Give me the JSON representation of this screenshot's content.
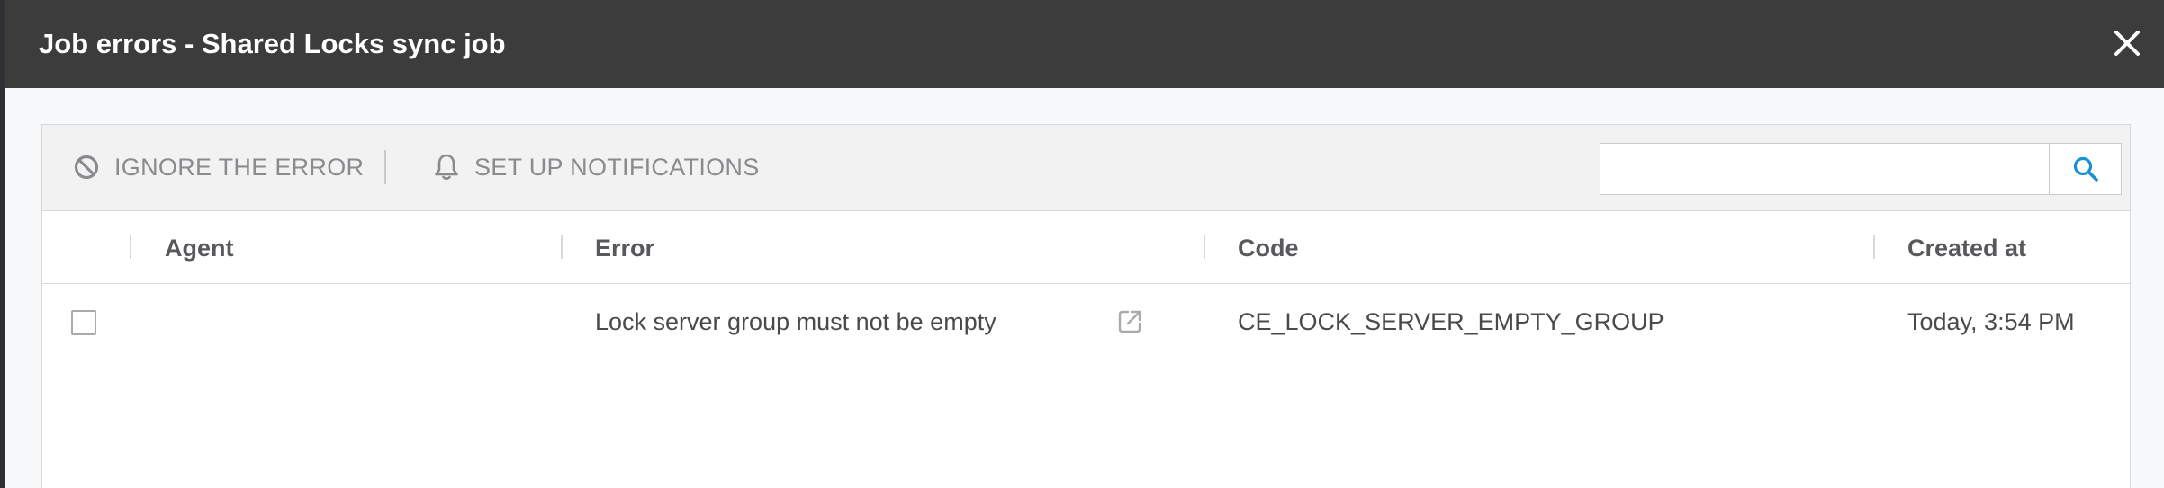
{
  "modal": {
    "title": "Job errors - Shared Locks sync job"
  },
  "toolbar": {
    "ignore_label": "IGNORE THE ERROR",
    "notifications_label": "SET UP NOTIFICATIONS",
    "search": {
      "value": "",
      "placeholder": ""
    }
  },
  "table": {
    "columns": [
      "Agent",
      "Error",
      "Code",
      "Created at"
    ],
    "rows": [
      {
        "agent": "",
        "error": "Lock server group must not be empty",
        "code": "CE_LOCK_SERVER_EMPTY_GROUP",
        "created_at": "Today, 3:54 PM"
      }
    ]
  },
  "icons": {
    "close": "close-icon",
    "ignore": "block-icon",
    "notifications": "bell-icon",
    "search": "search-icon",
    "external_link": "external-link-icon"
  },
  "colors": {
    "header_bg": "#3c3c3c",
    "accent": "#1a8fd4",
    "toolbar_text": "#8a8b8e"
  }
}
